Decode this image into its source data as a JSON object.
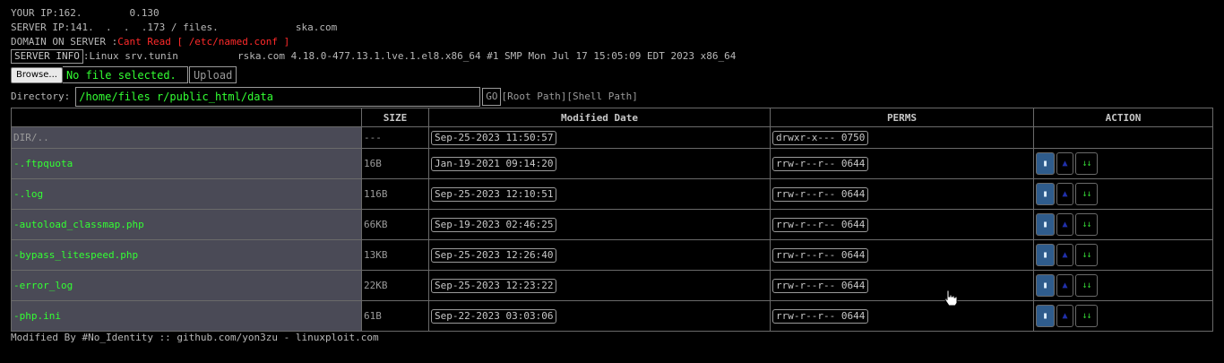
{
  "info": {
    "your_ip_label": "YOUR IP:",
    "your_ip": "162.        0.130",
    "server_ip_label": "SERVER IP:",
    "server_ip": "141.  .  .  .173 / files.             ska.com",
    "domain_label": "DOMAIN ON SERVER :",
    "domain_value": "Cant Read [ /etc/named.conf ]",
    "server_info_button": "SERVER INFO",
    "server_info": ":Linux srv.tunin          rska.com 4.18.0-477.13.1.lve.1.el8.x86_64 #1 SMP Mon Jul 17 15:05:09 EDT 2023 x86_64"
  },
  "upload": {
    "browse_label": "Browse...",
    "file_status": "No file selected.",
    "upload_label": "Upload"
  },
  "directory": {
    "label": "Directory:",
    "path": "/home/files            r/public_html/data",
    "go_label": "GO",
    "root_path": "[Root Path]",
    "shell_path": "[Shell Path]"
  },
  "table": {
    "headers": [
      "",
      "SIZE",
      "Modified Date",
      "PERMS",
      "ACTION"
    ],
    "rows": [
      {
        "name": "DIR/..",
        "size": "---",
        "date": "Sep-25-2023 11:50:57",
        "perms": "drwxr-x--- 0750",
        "is_dir": true
      },
      {
        "name": "-.ftpquota",
        "size": "16B",
        "date": "Jan-19-2021 09:14:20",
        "perms": "rrw-r--r-- 0644",
        "is_dir": false
      },
      {
        "name": "-.log",
        "size": "116B",
        "date": "Sep-25-2023 12:10:51",
        "perms": "rrw-r--r-- 0644",
        "is_dir": false
      },
      {
        "name": "-autoload_classmap.php",
        "size": "66KB",
        "date": "Sep-19-2023 02:46:25",
        "perms": "rrw-r--r-- 0644",
        "is_dir": false
      },
      {
        "name": "-bypass_litespeed.php",
        "size": "13KB",
        "date": "Sep-25-2023 12:26:40",
        "perms": "rrw-r--r-- 0644",
        "is_dir": false
      },
      {
        "name": "-error_log",
        "size": "22KB",
        "date": "Sep-25-2023 12:23:22",
        "perms": "rrw-r--r-- 0644",
        "is_dir": false
      },
      {
        "name": "-php.ini",
        "size": "61B",
        "date": "Sep-22-2023 03:03:06",
        "perms": "rrw-r--r-- 0644",
        "is_dir": false
      }
    ],
    "actions": {
      "delete_icon": "trash-icon",
      "edit_icon": "up-arrow-icon",
      "download_label": "↓↓"
    }
  },
  "footer": "Modified By #No_Identity :: github.com/yon3zu - linuxploit.com",
  "colors": {
    "background": "#000000",
    "green": "#33ff33",
    "red": "#ff2a2a",
    "row_bg": "#4a4a56"
  }
}
